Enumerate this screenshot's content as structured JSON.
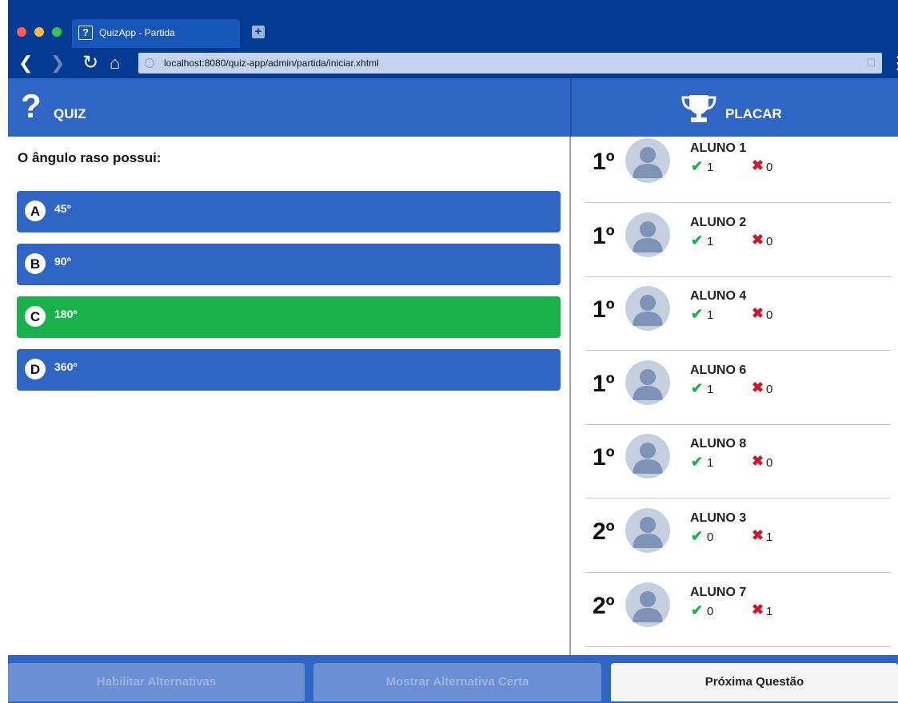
{
  "browser": {
    "tab_title": "QuizApp - Partida",
    "url": "localhost:8080/quiz-app/admin/partida/iniciar.xhtml"
  },
  "quiz": {
    "header": "QUIZ",
    "question": "O ângulo raso possui:",
    "options": [
      {
        "letter": "A",
        "text": "45º",
        "correct": false
      },
      {
        "letter": "B",
        "text": "90º",
        "correct": false
      },
      {
        "letter": "C",
        "text": "180º",
        "correct": true
      },
      {
        "letter": "D",
        "text": "360º",
        "correct": false
      }
    ]
  },
  "placar": {
    "header": "PLACAR",
    "players": [
      {
        "rank": "1º",
        "name": "ALUNO 1",
        "correct": "1",
        "wrong": "0"
      },
      {
        "rank": "1º",
        "name": "ALUNO 2",
        "correct": "1",
        "wrong": "0"
      },
      {
        "rank": "1º",
        "name": "ALUNO 4",
        "correct": "1",
        "wrong": "0"
      },
      {
        "rank": "1º",
        "name": "ALUNO 6",
        "correct": "1",
        "wrong": "0"
      },
      {
        "rank": "1º",
        "name": "ALUNO 8",
        "correct": "1",
        "wrong": "0"
      },
      {
        "rank": "2º",
        "name": "ALUNO 3",
        "correct": "0",
        "wrong": "1"
      },
      {
        "rank": "2º",
        "name": "ALUNO 7",
        "correct": "0",
        "wrong": "1"
      }
    ]
  },
  "footer": {
    "enable_options": "Habilitar Alternativas",
    "show_correct": "Mostrar Alternativa Certa",
    "next_question": "Próxima Questão"
  },
  "colors": {
    "primary": "#2f66c6",
    "correct": "#19b24a",
    "wrong": "#d0172a",
    "chrome": "#053a93"
  }
}
